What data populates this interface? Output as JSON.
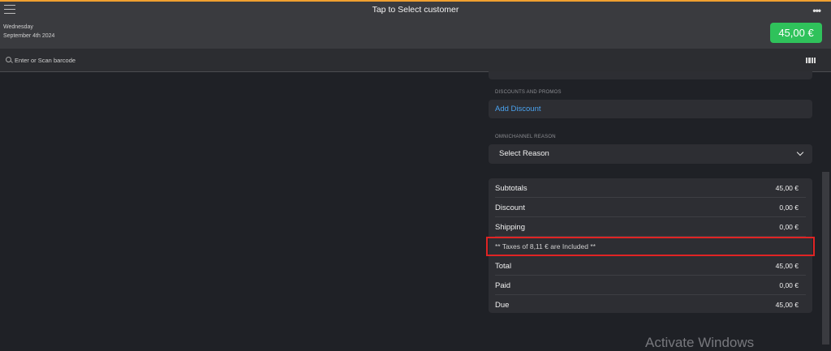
{
  "header": {
    "title": "Tap to Select customer",
    "date_weekday": "Wednesday",
    "date_full": "September 4th 2024",
    "total_amount": "45,00 €",
    "more_icon": "more-horizontal-icon",
    "menu_icon": "hamburger-menu-icon"
  },
  "search": {
    "placeholder": "Enter or Scan barcode",
    "icon": "search-icon",
    "barcode_icon": "barcode-icon"
  },
  "discounts": {
    "section_label": "DISCOUNTS AND PROMOS",
    "add_label": "Add Discount"
  },
  "omnichannel": {
    "section_label": "OMNICHANNEL REASON",
    "selected": "Select Reason"
  },
  "totals": {
    "rows": [
      {
        "label": "Subtotals",
        "value": "45,00 €"
      },
      {
        "label": "Discount",
        "value": "0,00 €"
      },
      {
        "label": "Shipping",
        "value": "0,00 €"
      }
    ],
    "tax_note": "** Taxes of 8,11 € are Included **",
    "rows_after": [
      {
        "label": "Total",
        "value": "45,00 €"
      },
      {
        "label": "Paid",
        "value": "0,00 €"
      },
      {
        "label": "Due",
        "value": "45,00 €"
      }
    ]
  },
  "watermark": "Activate Windows",
  "colors": {
    "accent_orange": "#f0a030",
    "total_green": "#2fc25b",
    "link_blue": "#4aa3f0",
    "highlight_red": "#e02424"
  }
}
